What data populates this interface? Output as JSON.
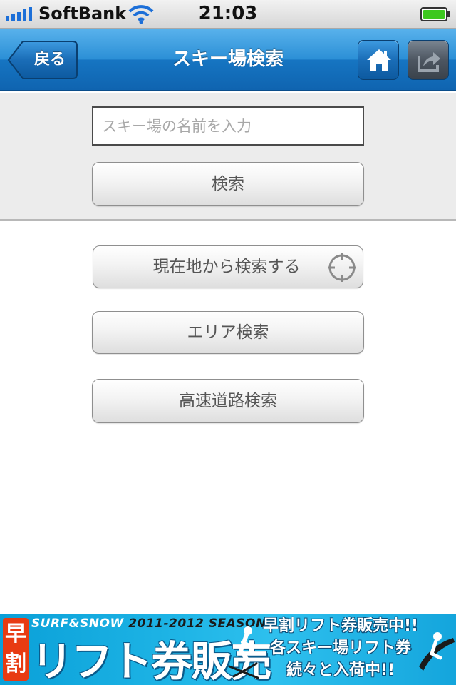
{
  "status_bar": {
    "carrier": "SoftBank",
    "time": "21:03",
    "signal_icon": "signal-bars-icon",
    "wifi_icon": "wifi-icon",
    "battery_icon": "battery-icon",
    "battery_level": 1.0,
    "battery_color": "#3cc81e"
  },
  "nav": {
    "back_label": "戻る",
    "title": "スキー場検索",
    "home_icon": "home-icon",
    "share_icon": "share-icon",
    "bar_color": "#1a7acb"
  },
  "search": {
    "placeholder": "スキー場の名前を入力",
    "value": "",
    "button_label": "検索"
  },
  "options": {
    "location_label": "現在地から検索する",
    "location_icon": "crosshair-icon",
    "area_label": "エリア検索",
    "highway_label": "高速道路検索"
  },
  "banner": {
    "badge": "早割",
    "brand": "SURF&SNOW",
    "season": "2011-2012 SEASON",
    "headline": "リフト券販売",
    "line1": "早割リフト券販売中!!",
    "line2": "各スキー場リフト券",
    "line3": "続々と入荷中!!",
    "accent_color": "#e83b12",
    "background_color": "#1fb5e6"
  }
}
